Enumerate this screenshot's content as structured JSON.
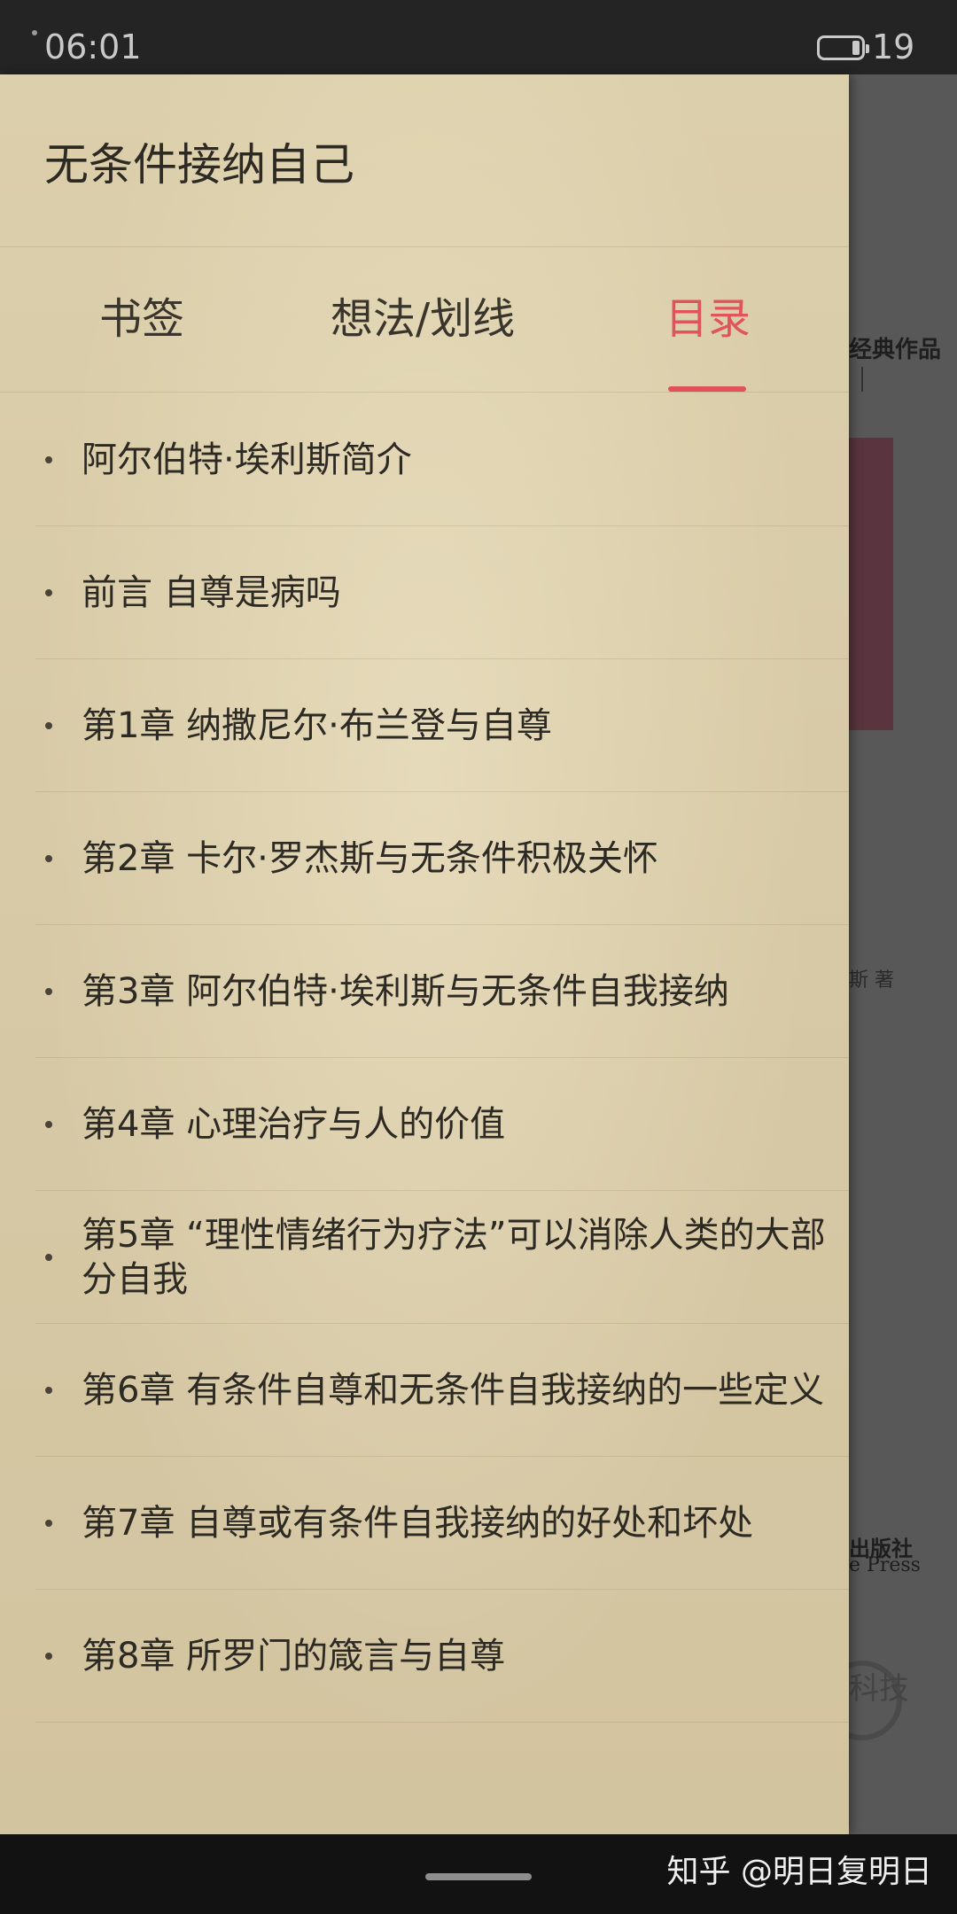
{
  "status_bar": {
    "time": "06:01",
    "battery_level": "19",
    "battery_fraction": 0.19
  },
  "drawer": {
    "book_title": "无条件接纳自己",
    "tabs": [
      {
        "label": "书签",
        "active": false
      },
      {
        "label": "想法/划线",
        "active": false
      },
      {
        "label": "目录",
        "active": true
      }
    ],
    "accent_color": "#e0545a",
    "toc": [
      {
        "text": "阿尔伯特·埃利斯简介"
      },
      {
        "text": "前言 自尊是病吗"
      },
      {
        "text": "第1章 纳撒尼尔·布兰登与自尊"
      },
      {
        "text": "第2章 卡尔·罗杰斯与无条件积极关怀"
      },
      {
        "text": "第3章 阿尔伯特·埃利斯与无条件自我接纳"
      },
      {
        "text": "第4章 心理治疗与人的价值"
      },
      {
        "text": "第5章 “理性情绪行为疗法”可以消除人类的大部分自我"
      },
      {
        "text": "第6章 有条件自尊和无条件自我接纳的一些定义"
      },
      {
        "text": "第7章 自尊或有条件自我接纳的好处和坏处"
      },
      {
        "text": "第8章 所罗门的箴言与自尊"
      }
    ]
  },
  "background_page": {
    "fragment_top": "经典作品",
    "fragment_author": "斯 著",
    "fragment_publisher_cn": "出版社",
    "fragment_publisher_en": "e Press",
    "fragment_logo_text": "科技"
  },
  "nav_bar": {
    "watermark": "知乎 @明日复明日"
  }
}
